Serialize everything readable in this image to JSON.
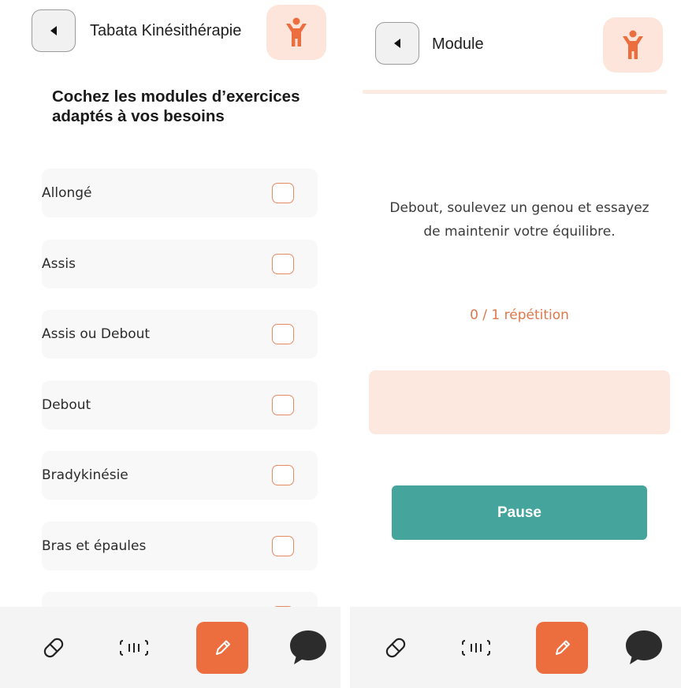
{
  "left": {
    "header": {
      "title": "Tabata Kinésithérapie"
    },
    "heading": "Cochez les modules d’exercices adaptés à vos besoins",
    "modules": [
      {
        "label": "Allongé",
        "checked": false
      },
      {
        "label": "Assis",
        "checked": false
      },
      {
        "label": "Assis ou Debout",
        "checked": false
      },
      {
        "label": "Debout",
        "checked": false
      },
      {
        "label": "Bradykinésie",
        "checked": false
      },
      {
        "label": "Bras et épaules",
        "checked": false
      },
      {
        "label": "",
        "checked": false
      }
    ]
  },
  "right": {
    "header": {
      "title": "Module"
    },
    "instruction": "Debout, soulevez un genou et essayez de maintenir votre équilibre.",
    "repetitions": "0 / 1 répétition",
    "pause_label": "Pause"
  },
  "nav": {
    "items": [
      {
        "icon": "pill-icon",
        "active": false
      },
      {
        "icon": "scan-icon",
        "active": false
      },
      {
        "icon": "pencil-icon",
        "active": true
      },
      {
        "icon": "chat-bubble-icon",
        "active": false
      }
    ]
  },
  "colors": {
    "accent": "#ec6e3f",
    "accent_light": "#fde5dc",
    "teal": "#45a59d",
    "checkbox_border": "#e58a63"
  }
}
